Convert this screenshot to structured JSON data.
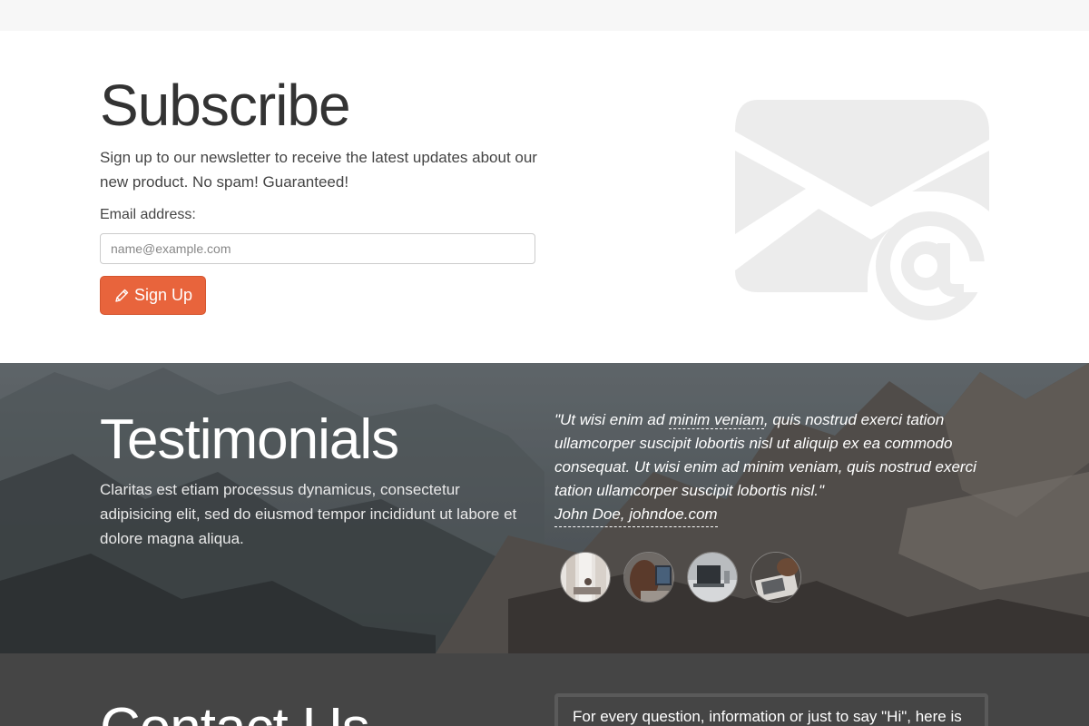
{
  "subscribe": {
    "title": "Subscribe",
    "description": "Sign up to our newsletter to receive the latest updates about our new product. No spam! Guaranteed!",
    "email_label": "Email address:",
    "email_placeholder": "name@example.com",
    "email_value": "",
    "button_label": "Sign Up",
    "button_icon": "pencil-icon",
    "art_icon": "envelope-at-icon",
    "accent_color": "#e8643c"
  },
  "testimonials": {
    "title": "Testimonials",
    "description": "Claritas est etiam processus dynamicus, consectetur adipisicing elit, sed do eiusmod tempor incididunt ut labore et dolore magna aliqua.",
    "quote_open": "\"Ut wisi enim ad ",
    "quote_highlight": "minim veniam",
    "quote_rest": ", quis nostrud exerci tation ullamcorper suscipit lobortis nisl ut aliquip ex ea commodo consequat. Ut wisi enim ad minim veniam, quis nostrud exerci tation ullamcorper suscipit lobortis nisl.\"",
    "author": "John Doe, johndoe.com",
    "avatars": [
      "person-window",
      "person-laptop",
      "laptop-desk",
      "person-typing"
    ]
  },
  "contact": {
    "title": "Contact Us",
    "intro": "For every question, information or just to say \"Hi\", here is"
  }
}
